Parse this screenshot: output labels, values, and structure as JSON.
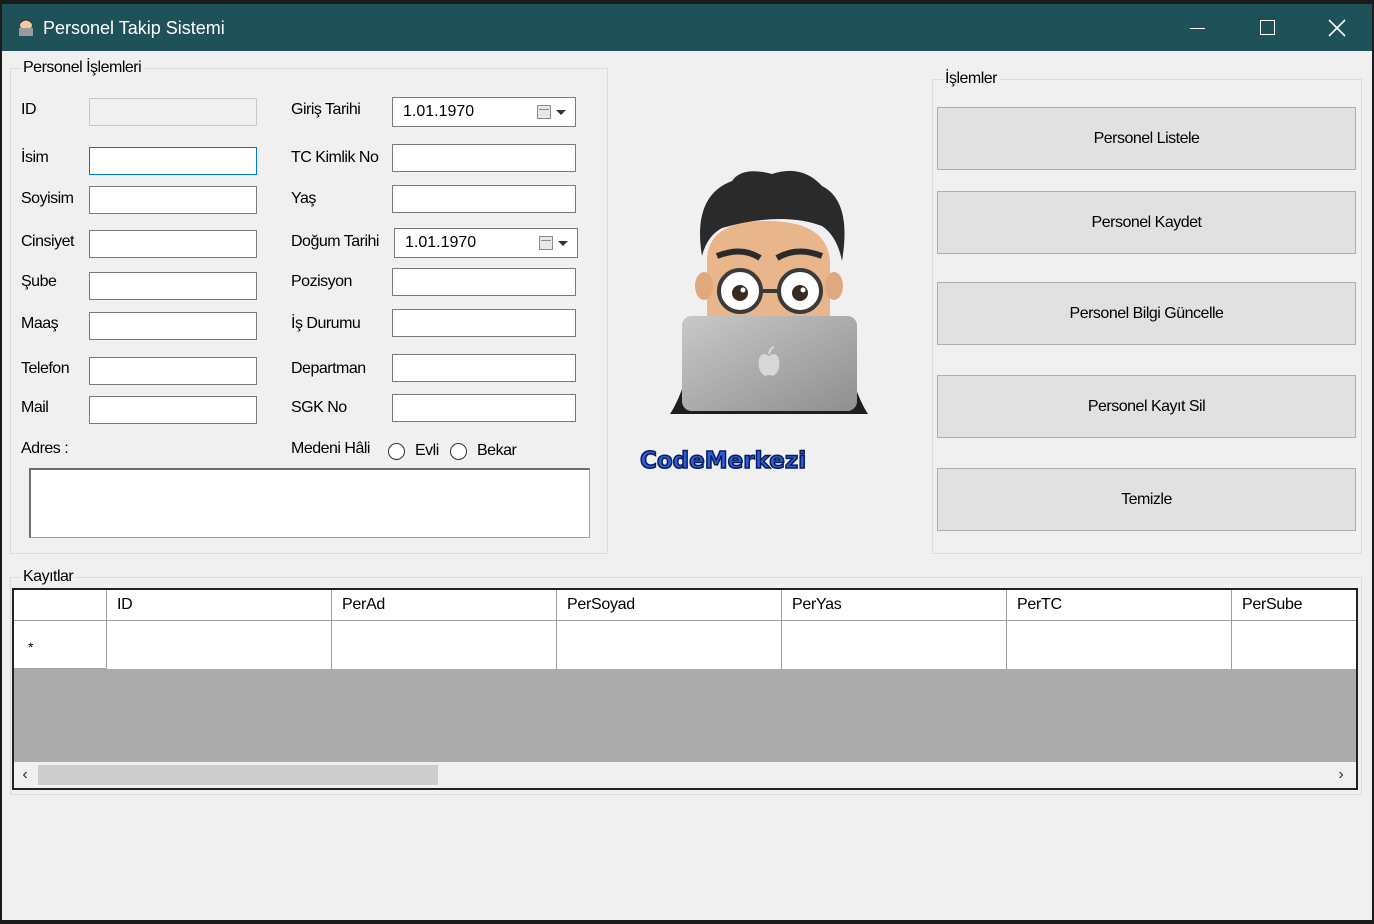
{
  "window": {
    "title": "Personel Takip Sistemi"
  },
  "personel_group": {
    "legend": "Personel İşlemleri",
    "left_fields": [
      {
        "label": "ID",
        "value": ""
      },
      {
        "label": "İsim",
        "value": ""
      },
      {
        "label": "Soyisim",
        "value": ""
      },
      {
        "label": "Cinsiyet",
        "value": ""
      },
      {
        "label": "Şube",
        "value": ""
      },
      {
        "label": "Maaş",
        "value": ""
      },
      {
        "label": "Telefon",
        "value": ""
      },
      {
        "label": "Mail",
        "value": ""
      }
    ],
    "right_fields": {
      "giris_tarihi": {
        "label": "Giriş Tarihi",
        "value": "1.01.1970"
      },
      "tc_kimlik_no": {
        "label": "TC Kimlik No",
        "value": ""
      },
      "yas": {
        "label": "Yaş",
        "value": ""
      },
      "dogum_tarihi": {
        "label": "Doğum Tarihi",
        "value": "1.01.1970"
      },
      "pozisyon": {
        "label": "Pozisyon",
        "value": ""
      },
      "is_durumu": {
        "label": "İş Durumu",
        "value": ""
      },
      "departman": {
        "label": "Departman",
        "value": ""
      },
      "sgk_no": {
        "label": "SGK No",
        "value": ""
      }
    },
    "adres_label": "Adres :",
    "medeni_hali": {
      "label": "Medeni Hâli",
      "options": [
        "Evli",
        "Bekar"
      ]
    }
  },
  "logo": {
    "text": "CodeMerkezi"
  },
  "islemler_group": {
    "legend": "İşlemler",
    "buttons": [
      "Personel Listele",
      "Personel Kaydet",
      "Personel Bilgi Güncelle",
      "Personel Kayıt Sil",
      "Temizle"
    ]
  },
  "kayitlar_group": {
    "legend": "Kayıtlar",
    "columns": [
      "ID",
      "PerAd",
      "PerSoyad",
      "PerYas",
      "PerTC",
      "PerSube"
    ],
    "new_row_marker": "*"
  },
  "colors": {
    "titlebar": "#1e5158",
    "focus_border": "#0078d7",
    "grid_background": "#ababab"
  }
}
